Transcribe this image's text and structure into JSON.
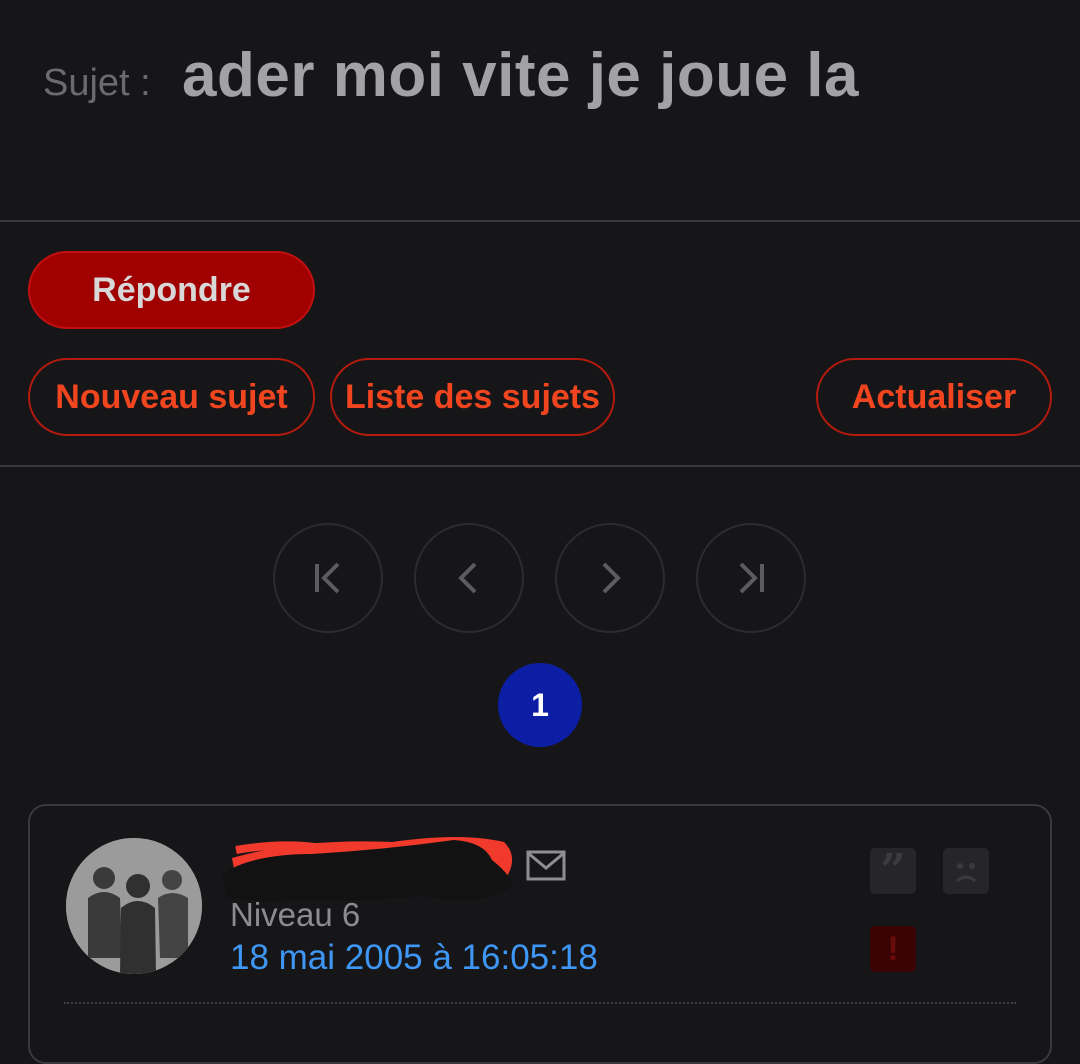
{
  "topic": {
    "prefix": "Sujet :",
    "title": "ader moi vite je joue la"
  },
  "actions": {
    "reply_label": "Répondre",
    "new_topic_label": "Nouveau sujet",
    "topic_list_label": "Liste des sujets",
    "refresh_label": "Actualiser"
  },
  "pagination": {
    "controls": [
      "first-page-icon",
      "previous-page-icon",
      "next-page-icon",
      "last-page-icon"
    ],
    "current_page": "1"
  },
  "post": {
    "level": "Niveau 6",
    "date": "18 mai 2005 à 16:05:18",
    "icons": [
      "mail-icon",
      "quote-icon",
      "sad-face-icon",
      "report-icon"
    ]
  },
  "colors": {
    "background": "#161618",
    "primary_button": "#a00000",
    "outline_accent": "#f0451f",
    "page_active": "#0c1ea3",
    "date_link": "#3f97f5"
  }
}
